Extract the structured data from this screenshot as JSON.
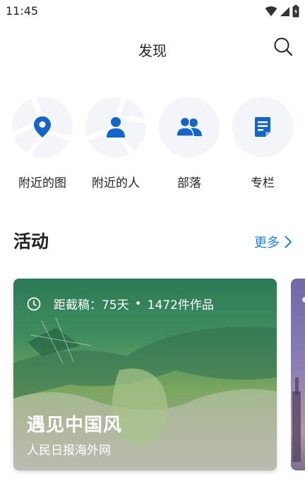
{
  "status_bar": {
    "time": "11:45"
  },
  "header": {
    "title": "发现"
  },
  "quick_links": [
    {
      "label": "附近的图",
      "icon": "location-pin-icon"
    },
    {
      "label": "附近的人",
      "icon": "person-icon"
    },
    {
      "label": "部落",
      "icon": "group-icon"
    },
    {
      "label": "专栏",
      "icon": "document-icon"
    }
  ],
  "activities": {
    "title": "活动",
    "more_label": "更多",
    "card": {
      "deadline": "距截稿：75天",
      "separator": "•",
      "works": "1472件作品",
      "title": "遇见中国风",
      "subtitle": "人民日报海外网"
    }
  },
  "colors": {
    "accent": "#1d7fe0",
    "icon_blue": "#1565c8",
    "circle_bg": "#f3f5f8"
  }
}
